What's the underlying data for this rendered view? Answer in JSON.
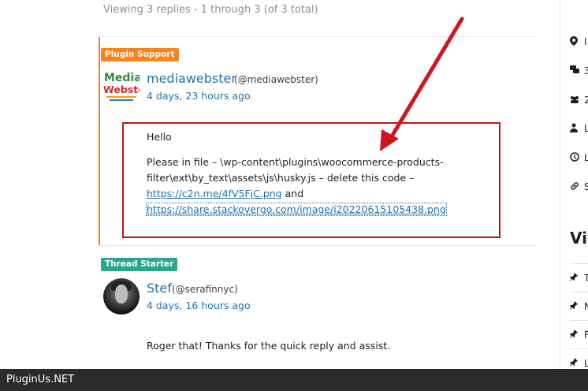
{
  "viewing": "Viewing 3 replies - 1 through 3 (of 3 total)",
  "replies": [
    {
      "badge": "Plugin Support",
      "avatar_text_top": "Media",
      "avatar_text_bottom": "Webster",
      "author": "mediawebster",
      "handle": "(@mediawebster)",
      "date": "4 days, 23 hours ago",
      "hello": "Hello",
      "body": "Please in file – \\wp-content\\plugins\\woocommerce-products-filter\\ext\\by_text\\assets\\js\\husky.js – delete this code –",
      "link1": "https://c2n.me/4fV5FjC.png",
      "and": "and",
      "link2": "https://share.stackovergo.com/image/i20220615105438.png"
    },
    {
      "badge": "Thread Starter",
      "author": "Stef",
      "handle": "(@serafinnyc)",
      "date": "4 days, 16 hours ago",
      "body": "Roger that! Thanks for the quick reply and assist."
    }
  ],
  "sidebar": {
    "items": [
      {
        "icon": "location-icon",
        "text": "I"
      },
      {
        "icon": "comments-icon",
        "text": "3"
      },
      {
        "icon": "users-icon",
        "text": "2"
      },
      {
        "icon": "user-icon",
        "text": "L"
      },
      {
        "icon": "clock-icon",
        "text": "L"
      },
      {
        "icon": "link-icon",
        "text": "S"
      }
    ],
    "heading": "Vie",
    "pins": [
      "T",
      "N",
      "F",
      "L"
    ]
  },
  "footer": "PluginUs.NET",
  "colors": {
    "link": "#2271b1",
    "support_badge": "#f7841b",
    "starter_badge": "#2aa88a",
    "highlight_box": "#c0141b",
    "arrow": "#d0161d"
  }
}
